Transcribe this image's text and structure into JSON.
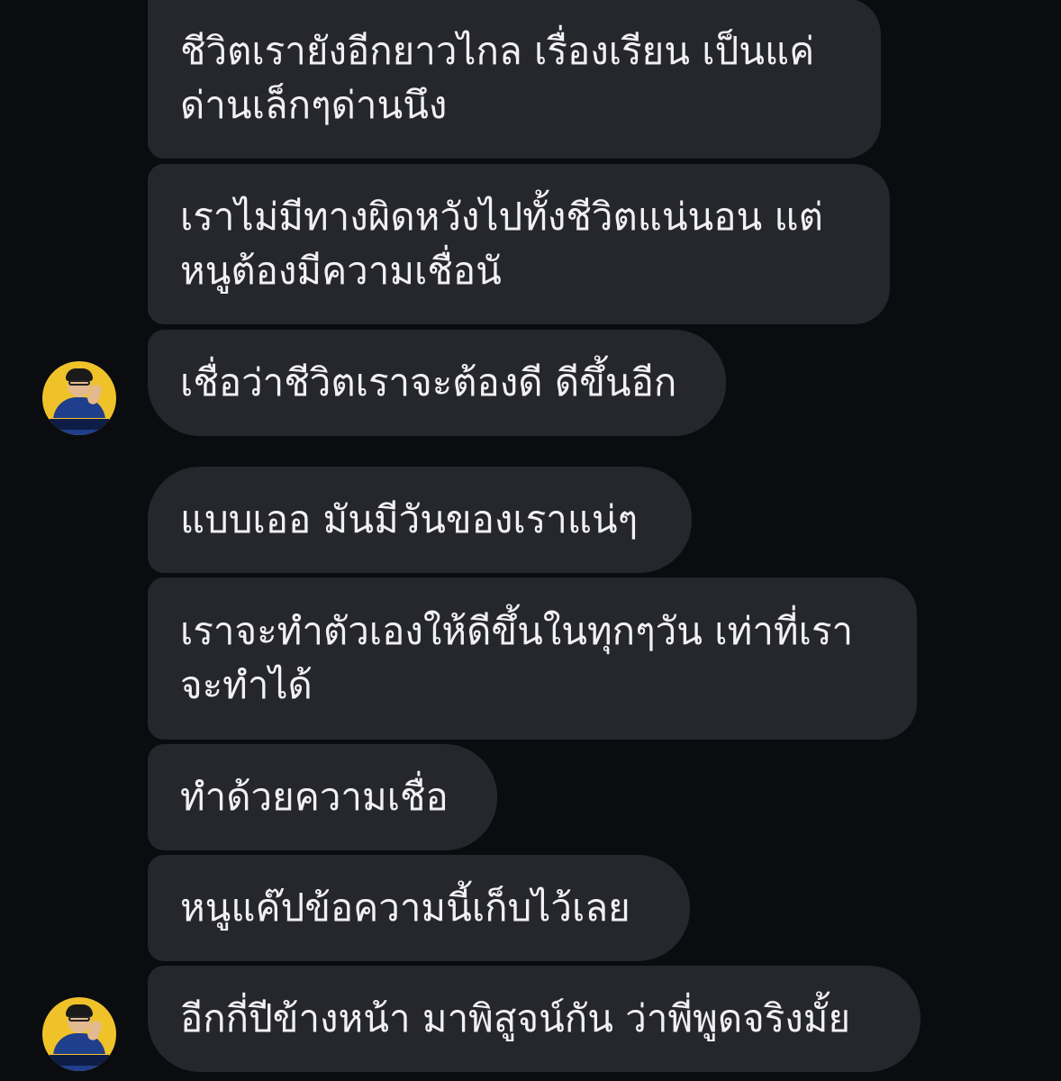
{
  "messages": [
    {
      "lines": [
        "ชีวิตเรายังอีกยาวไกล เรื่องเรียน เป็นแค่",
        "ด่านเล็กๆด่านนึง"
      ]
    },
    {
      "lines": [
        "เราไม่มีทางผิดหวังไปทั้งชีวิตแน่นอน แต่",
        "หนูต้องมีความเชื่อนั"
      ]
    },
    {
      "lines": [
        "เชื่อว่าชีวิตเราจะต้องดี ดีขึ้นอีก"
      ]
    },
    {
      "lines": [
        "แบบเออ มันมีวันของเราแน่ๆ"
      ]
    },
    {
      "lines": [
        "เราจะทำตัวเองให้ดีขึ้นในทุกๆวัน เท่าที่เรา",
        "จะทำได้"
      ]
    },
    {
      "lines": [
        "ทำด้วยความเชื่อ"
      ]
    },
    {
      "lines": [
        "หนูแค๊ปข้อความนี้เก็บไว้เลย"
      ]
    },
    {
      "lines": [
        "อีกกี่ปีข้างหน้า มาพิสูจน์กัน ว่าพี่พูดจริงมั้ย"
      ]
    }
  ],
  "colors": {
    "background": "#0b0c10",
    "bubble": "#26272c",
    "text": "#f1f1f3",
    "avatar_bg": "#f0c22a"
  },
  "icons": {
    "avatar": "profile-avatar-icon"
  }
}
